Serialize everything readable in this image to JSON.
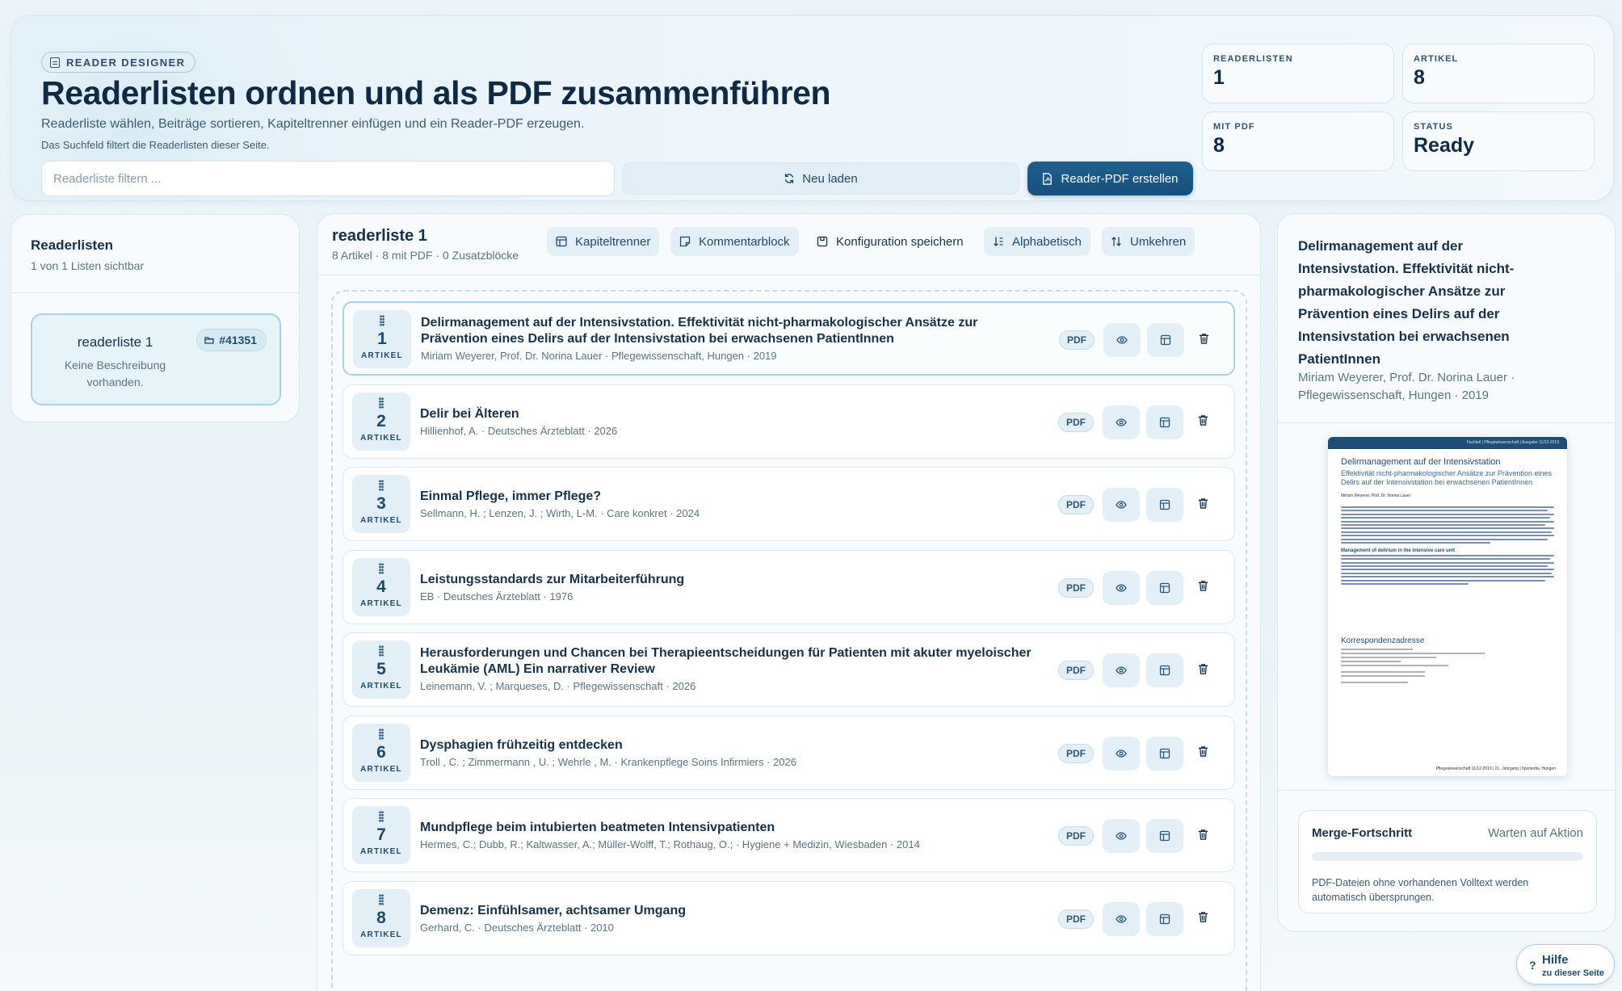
{
  "hero": {
    "badge": "READER DESIGNER",
    "title": "Readerlisten ordnen und als PDF zusammenführen",
    "subtitle": "Readerliste wählen, Beiträge sortieren, Kapiteltrenner einfügen und ein Reader-PDF erzeugen.",
    "hint": "Das Suchfeld filtert die Readerlisten dieser Seite.",
    "search_placeholder": "Readerliste filtern ...",
    "reload_label": "Neu laden",
    "create_label": "Reader-PDF erstellen",
    "stats": [
      {
        "label": "READERLISTEN",
        "value": "1"
      },
      {
        "label": "ARTIKEL",
        "value": "8"
      },
      {
        "label": "MIT PDF",
        "value": "8"
      },
      {
        "label": "STATUS",
        "value": "Ready"
      }
    ]
  },
  "sidebar": {
    "title": "Readerlisten",
    "count": "1 von 1 Listen sichtbar",
    "lists": [
      {
        "name": "readerliste 1",
        "description": "Keine Beschreibung vorhanden.",
        "id": "#41351"
      }
    ]
  },
  "main": {
    "title": "readerliste 1",
    "summary": "8 Artikel · 8 mit PDF · 0 Zusatzblöcke",
    "toolbar": {
      "chapter": "Kapiteltrenner",
      "comment": "Kommentarblock",
      "save": "Konfiguration speichern",
      "alpha": "Alphabetisch",
      "reverse": "Umkehren"
    },
    "article_label": "ARTIKEL",
    "pdf_badge": "PDF",
    "articles": [
      {
        "n": "1",
        "title": "Delirmanagement auf der Intensivstation. Effektivität nicht-pharmakologischer Ansätze zur Prävention eines Delirs auf der Intensivstation bei erwachsenen PatientInnen",
        "meta": "Miriam Weyerer, Prof. Dr. Norina Lauer · Pflegewissenschaft, Hungen · 2019"
      },
      {
        "n": "2",
        "title": "Delir bei Älteren",
        "meta": "Hillienhof, A. · Deutsches Ärzteblatt · 2026"
      },
      {
        "n": "3",
        "title": "Einmal Pflege, immer Pflege?",
        "meta": "Sellmann, H. ; Lenzen, J. ; Wirth, L-M. · Care konkret · 2024"
      },
      {
        "n": "4",
        "title": "Leistungsstandards zur Mitarbeiterführung",
        "meta": "EB · Deutsches Ärzteblatt · 1976"
      },
      {
        "n": "5",
        "title": "Herausforderungen und Chancen bei Therapieentscheidungen für Patienten mit akuter myeloischer Leukämie (AML) Ein narrativer Review",
        "meta": "Leinemann, V. ; Marqueses, D. · Pflegewissenschaft · 2026"
      },
      {
        "n": "6",
        "title": "Dysphagien frühzeitig entdecken",
        "meta": "Troll , C. ; Zimmermann , U. ; Wehrle , M. · Krankenpflege Soins Infirmiers · 2026"
      },
      {
        "n": "7",
        "title": "Mundpflege beim intubierten beatmeten Intensivpatienten",
        "meta": "Hermes, C.; Dubb, R.; Kaltwasser, A.; Müller-Wolff, T.; Rothaug, O.; · Hygiene + Medizin, Wiesbaden · 2014"
      },
      {
        "n": "8",
        "title": "Demenz: Einfühlsamer, achtsamer Umgang",
        "meta": "Gerhard, C. · Deutsches Ärzteblatt · 2010"
      }
    ]
  },
  "preview": {
    "title": "Delirmanagement auf der Intensivstation. Effektivität nicht-pharmakologischer Ansätze zur Prävention eines Delirs auf der Intensivstation bei erwachsenen PatientInnen",
    "meta": "Miriam Weyerer, Prof. Dr. Norina Lauer · Pflegewissenschaft, Hungen · 2019",
    "thumb": {
      "header": "Fachteil | Pflegewissenschaft | Ausgabe 11/12-2019",
      "heading": "Delirmanagement auf der Intensivstation",
      "subheading": "Effektivität nicht-pharmakologischer Ansätze zur Prävention eines Delirs auf der Intensivstation bei erwachsenen PatientInnen",
      "authors": "Miriam Weyerer, Prof. Dr. Norina Lauer",
      "section": "Management of delirium in the intensive care unit",
      "contact": "Korrespondenzadresse",
      "footer": "Pflegewissenschaft 11/12-2019 | 21. Jahrgang | hpsmedia, Hungen"
    },
    "merge": {
      "title": "Merge-Fortschritt",
      "status": "Warten auf Aktion",
      "progress": 0,
      "note": "PDF-Dateien ohne vorhandenen Volltext werden automatisch übersprungen."
    }
  },
  "help": {
    "q": "?",
    "label": "Hilfe",
    "sub": "zu dieser Seite"
  }
}
